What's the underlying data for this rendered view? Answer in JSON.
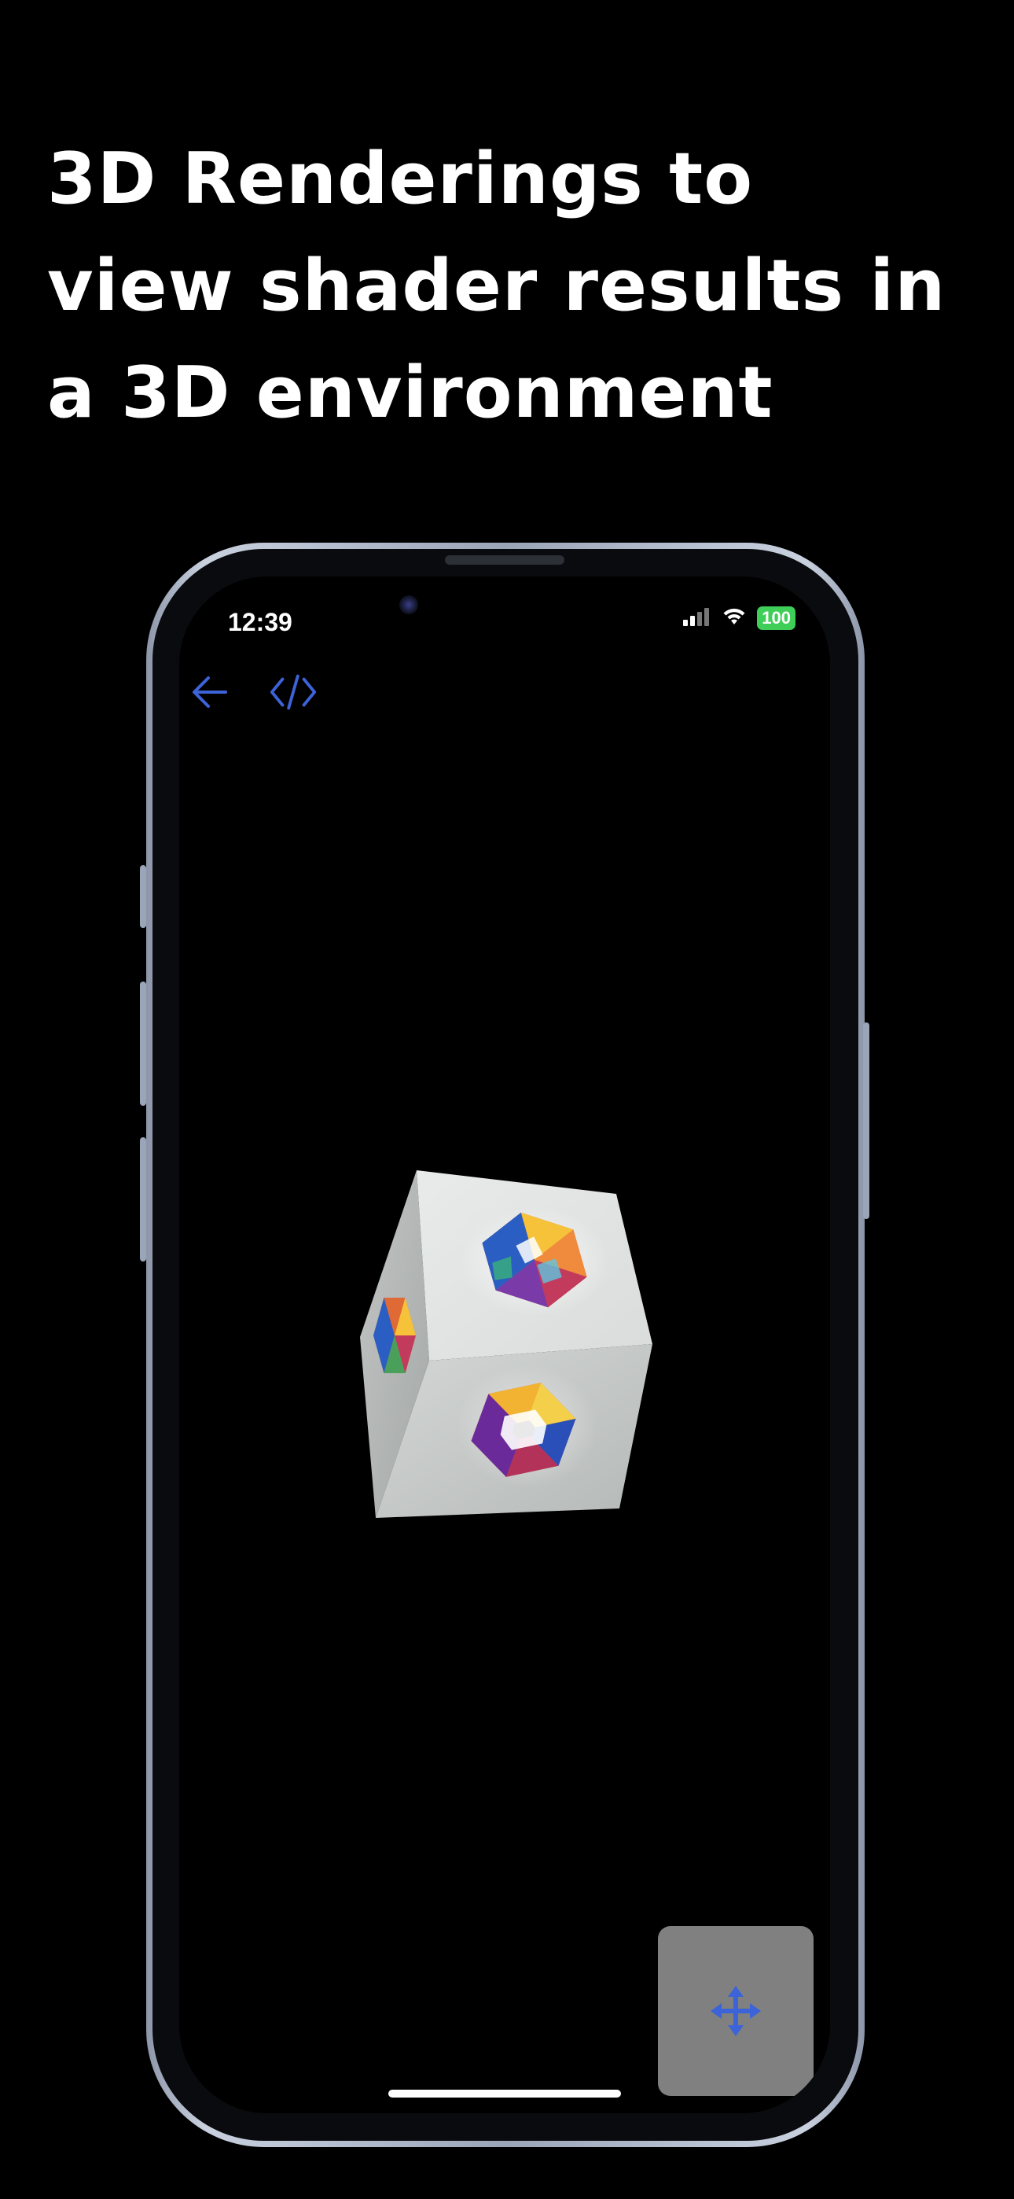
{
  "headline": {
    "line1": "3D Renderings to",
    "line2": "view shader results in",
    "line3": "a 3D environment"
  },
  "status_bar": {
    "time": "12:39",
    "battery": "100",
    "signal_icon": "cellular-signal-icon",
    "wifi_icon": "wifi-icon"
  },
  "toolbar": {
    "back_icon": "arrow-left-icon",
    "code_icon": "code-icon",
    "accent_color": "#3d63d8"
  },
  "viewer": {
    "object": "cube",
    "texture": "colorful hexagon logo"
  },
  "control_pad": {
    "icon": "move-arrows-icon",
    "background": "#808080"
  },
  "colors": {
    "background": "#000000",
    "headline": "#ffffff",
    "battery": "#3fcf58"
  }
}
